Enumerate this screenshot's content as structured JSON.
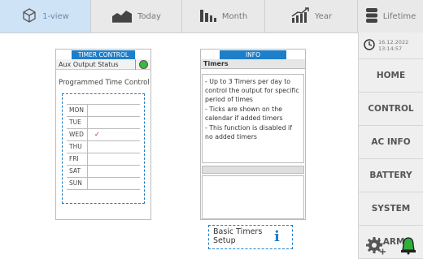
{
  "tabs": [
    {
      "label": "1-view",
      "icon": "cube-icon",
      "active": true
    },
    {
      "label": "Today",
      "icon": "area-chart-icon",
      "active": false
    },
    {
      "label": "Month",
      "icon": "bar-chart-icon",
      "active": false
    },
    {
      "label": "Year",
      "icon": "growth-chart-icon",
      "active": false
    },
    {
      "label": "Lifetime",
      "icon": "database-icon",
      "active": false
    }
  ],
  "clock": {
    "date": "16.12.2022",
    "time": "13:14:57"
  },
  "nav": [
    "HOME",
    "CONTROL",
    "AC INFO",
    "BATTERY",
    "SYSTEM",
    "ALARMS"
  ],
  "timer_control": {
    "title": "TIMER CONTROL",
    "aux_label": "Aux Output Status",
    "aux_status_color": "#3db83d",
    "programmed_label": "Programmed Time Control",
    "days": [
      {
        "name": "MON",
        "checked": false
      },
      {
        "name": "TUE",
        "checked": false
      },
      {
        "name": "WED",
        "checked": true
      },
      {
        "name": "THU",
        "checked": false
      },
      {
        "name": "FRI",
        "checked": false
      },
      {
        "name": "SAT",
        "checked": false
      },
      {
        "name": "SUN",
        "checked": false
      }
    ],
    "check_mark": "✓"
  },
  "info": {
    "title": "INFO",
    "header": "Timers",
    "lines": [
      "- Up to 3 Timers per day to control the output for specific period of times",
      "- Ticks are shown on the calendar if added timers",
      "- This function is disabled if no added timers"
    ]
  },
  "basic_timers": {
    "label": "Basic Timers\nSetup",
    "icon": "info-icon"
  },
  "colors": {
    "accent": "#1f7ec8",
    "active_tab": "#cfe3f6",
    "status_green": "#3db83d",
    "check": "#c2185b"
  }
}
